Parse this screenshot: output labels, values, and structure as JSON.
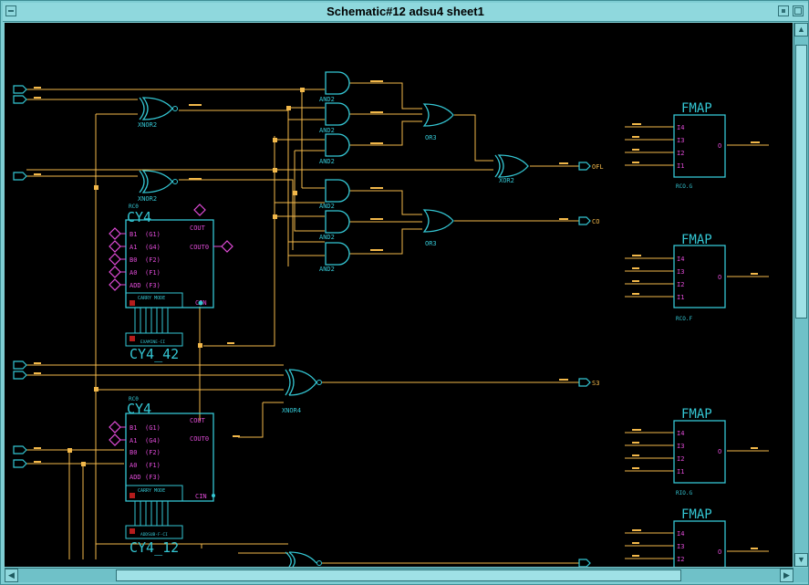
{
  "window": {
    "title": "Schematic#12 adsu4 sheet1"
  },
  "colors": {
    "wire": "#f2b84a",
    "symbol": "#34c6d3",
    "pin": "#e14bd8",
    "background": "#000000"
  },
  "icons": {
    "menu": "window-menu-icon",
    "minimize": "minimize-icon",
    "maximize": "maximize-icon"
  },
  "gates": {
    "xnor_top": "XNOR2",
    "xnor_mid": "XNOR2",
    "and_1": "AND2",
    "and_2": "AND2",
    "and_3": "AND2",
    "and_4": "AND2",
    "and_5": "AND2",
    "and_6": "AND2",
    "or_top": "OR3",
    "or_bot": "OR3",
    "xor_out": "XOR2",
    "xnor4": "XNOR4"
  },
  "cy4_top": {
    "title": "CY4",
    "name": "CY4_42",
    "inst": "RC0",
    "pins_left": [
      "B1",
      "A1",
      "B0",
      "A0",
      "ADD"
    ],
    "pins_mid": [
      "(G1)",
      "(G4)",
      "(F2)",
      "(F1)",
      "(F3)"
    ],
    "cout": "COUT",
    "cout0": "COUT0",
    "cin": "CIN",
    "carry_mode": "CARRY MODE",
    "mode_name": "EXAMINE-CI"
  },
  "cy4_bot": {
    "title": "CY4",
    "name": "CY4_12",
    "inst": "RC0",
    "pins_left": [
      "B1",
      "A1",
      "B0",
      "A0",
      "ADD"
    ],
    "pins_mid": [
      "(G1)",
      "(G4)",
      "(F2)",
      "(F1)",
      "(F3)"
    ],
    "cout": "COUT",
    "cout0": "COUT0",
    "cin": "CIN",
    "carry_mode": "CARRY MODE",
    "mode_name": "ADDSUB-F-CI"
  },
  "fmaps": [
    {
      "title": "FMAP",
      "pins": [
        "I4",
        "I3",
        "I2",
        "I1"
      ],
      "out": "O",
      "inst": "RCO.G"
    },
    {
      "title": "FMAP",
      "pins": [
        "I4",
        "I3",
        "I2",
        "I1"
      ],
      "out": "O",
      "inst": "RCO.F"
    },
    {
      "title": "FMAP",
      "pins": [
        "I4",
        "I3",
        "I2",
        "I1"
      ],
      "out": "O",
      "inst": "RIO.G"
    },
    {
      "title": "FMAP",
      "pins": [
        "I4",
        "I3",
        "I2",
        "I1"
      ],
      "out": "O",
      "inst": ""
    }
  ],
  "ports": {
    "ofl": "OFL",
    "co": "CO",
    "s3": "S3"
  }
}
